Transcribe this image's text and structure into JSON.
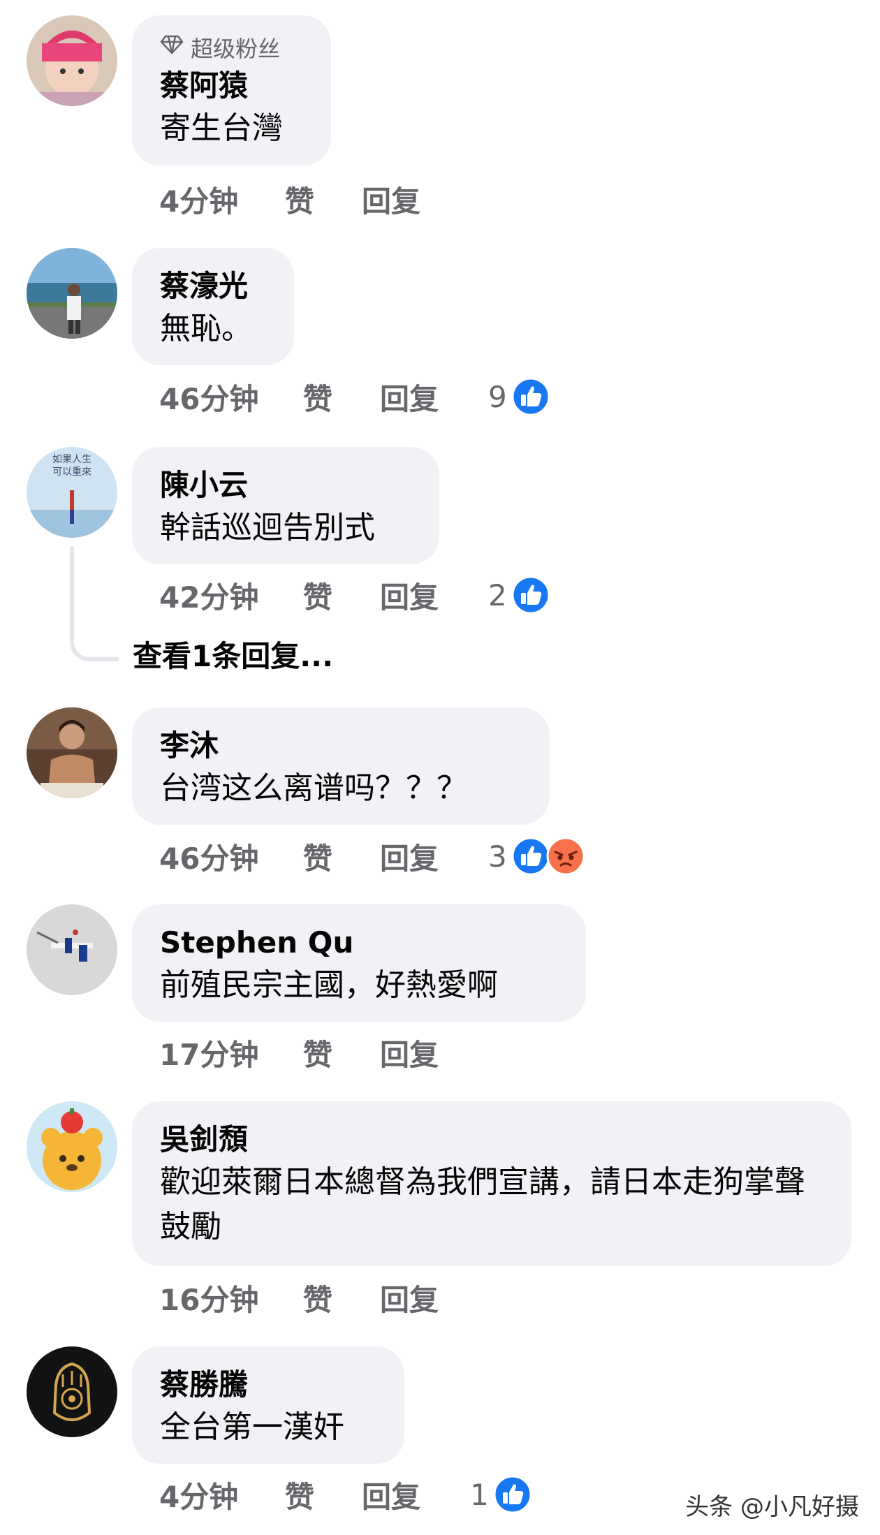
{
  "comments": [
    {
      "badge": "超级粉丝",
      "name": "蔡阿猿",
      "text": "寄生台灣",
      "time": "4分钟",
      "like": "赞",
      "reply": "回复",
      "reaction_count": "",
      "reactions": []
    },
    {
      "badge": "",
      "name": "蔡濠光",
      "text": "無恥。",
      "time": "46分钟",
      "like": "赞",
      "reply": "回复",
      "reaction_count": "9",
      "reactions": [
        "like"
      ]
    },
    {
      "badge": "",
      "name": "陳小云",
      "text": "幹話巡迴告別式",
      "time": "42分钟",
      "like": "赞",
      "reply": "回复",
      "reaction_count": "2",
      "reactions": [
        "like"
      ],
      "view_replies": "查看1条回复..."
    },
    {
      "badge": "",
      "name": "李沐",
      "text": "台湾这么离谱吗？？？",
      "time": "46分钟",
      "like": "赞",
      "reply": "回复",
      "reaction_count": "3",
      "reactions": [
        "like",
        "angry"
      ]
    },
    {
      "badge": "",
      "name": "Stephen Qu",
      "text": "前殖民宗主國，好熱愛啊",
      "time": "17分钟",
      "like": "赞",
      "reply": "回复",
      "reaction_count": "",
      "reactions": []
    },
    {
      "badge": "",
      "name": "吳釗頹",
      "text": "歡迎萊爾日本總督為我們宣講，請日本走狗掌聲鼓勵",
      "time": "16分钟",
      "like": "赞",
      "reply": "回复",
      "reaction_count": "",
      "reactions": []
    },
    {
      "badge": "",
      "name": "蔡勝騰",
      "text": "全台第一漢奸",
      "time": "4分钟",
      "like": "赞",
      "reply": "回复",
      "reaction_count": "1",
      "reactions": [
        "like"
      ]
    }
  ],
  "watermark": "头条 @小凡好摄",
  "colors": {
    "bubble": "#f0f2f5",
    "secondary_text": "#65676b",
    "like_blue": "#1877f2",
    "angry_orange": "#f7714c"
  }
}
